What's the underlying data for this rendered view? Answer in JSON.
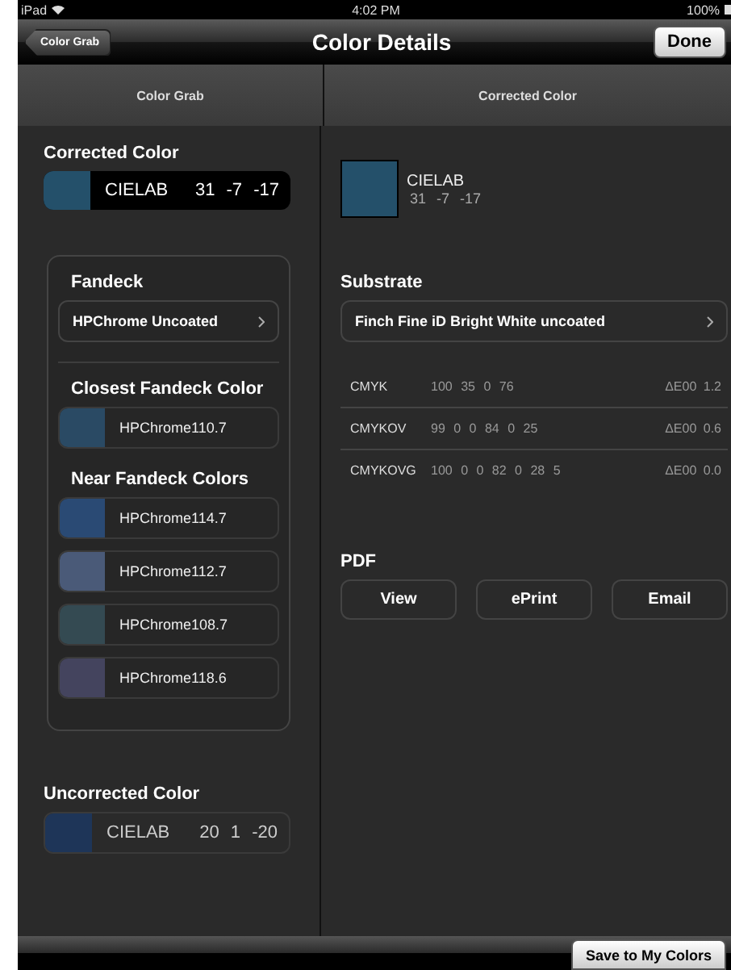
{
  "status_bar": {
    "device": "iPad",
    "time": "4:02 PM",
    "battery": "100%"
  },
  "nav_bar": {
    "back": "Color Grab",
    "title": "Color Details",
    "done": "Done"
  },
  "columns": [
    {
      "title": "Color Grab"
    },
    {
      "title": "Corrected Color"
    }
  ],
  "left": {
    "corrected": {
      "label": "Corrected Color",
      "space": "CIELAB",
      "values": "31 -7 -17",
      "color": "#24506a"
    },
    "fandeck": {
      "label": "Fandeck",
      "value": "HPChrome Uncoated"
    },
    "closest": {
      "label": "Closest Fandeck Color",
      "item": {
        "name": "HPChrome110.7",
        "color": "#2a4a64"
      }
    },
    "near": {
      "label": "Near Fandeck Colors",
      "items": [
        {
          "name": "HPChrome114.7",
          "color": "#2a4a74"
        },
        {
          "name": "HPChrome112.7",
          "color": "#4a5a78"
        },
        {
          "name": "HPChrome108.7",
          "color": "#344a52"
        },
        {
          "name": "HPChrome118.6",
          "color": "#44445e"
        }
      ]
    },
    "uncorrected": {
      "label": "Uncorrected Color",
      "space": "CIELAB",
      "values": "20 1 -20",
      "color": "#1e3558"
    }
  },
  "right": {
    "swatch": {
      "space": "CIELAB",
      "values": "31 -7 -17",
      "color": "#24506a"
    },
    "substrate": {
      "label": "Substrate",
      "value": "Finch Fine iD Bright White uncoated"
    },
    "separations": [
      {
        "name": "CMYK",
        "values": "100 35 0 76",
        "delta": "ΔE00 1.2"
      },
      {
        "name": "CMYKOV",
        "values": "99 0 0 84 0 25",
        "delta": "ΔE00 0.6"
      },
      {
        "name": "CMYKOVG",
        "values": "100 0 0 82 0 28 5",
        "delta": "ΔE00 0.0"
      }
    ],
    "pdf": {
      "label": "PDF",
      "buttons": [
        "View",
        "ePrint",
        "Email"
      ]
    }
  },
  "toolbar": {
    "save": "Save to My Colors"
  }
}
